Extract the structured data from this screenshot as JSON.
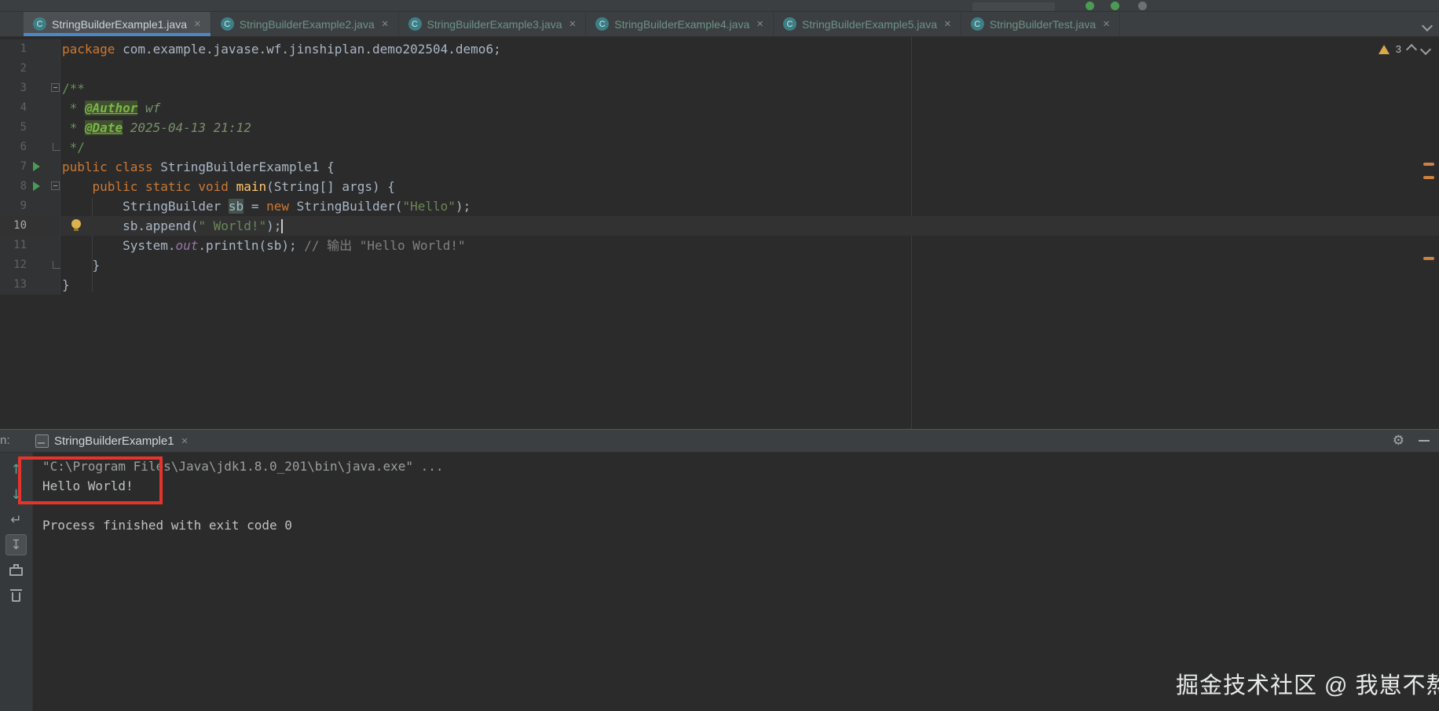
{
  "colors": {
    "accent_blue": "#4a88c7",
    "keyword_orange": "#cc7832",
    "string_green": "#6a8759",
    "warning_orange": "#d9a74a",
    "run_green": "#499c54",
    "annotation_red": "#e5342b",
    "editor_bg": "#2b2b2b",
    "panel_bg": "#3c3f41"
  },
  "tabs": {
    "icon_letter": "C",
    "close_glyph": "×",
    "items": [
      {
        "label": "StringBuilderExample1.java",
        "active": true
      },
      {
        "label": "StringBuilderExample2.java",
        "active": false
      },
      {
        "label": "StringBuilderExample3.java",
        "active": false
      },
      {
        "label": "StringBuilderExample4.java",
        "active": false
      },
      {
        "label": "StringBuilderExample5.java",
        "active": false
      },
      {
        "label": "StringBuilderTest.java",
        "active": false
      }
    ]
  },
  "inspections": {
    "warning_count": "3"
  },
  "editor": {
    "scroll_marks": [
      160,
      177,
      280
    ],
    "lines": [
      {
        "num": "1",
        "segments": [
          {
            "c": "kw",
            "t": "package "
          },
          {
            "c": "pl",
            "t": "com.example.javase.wf.jinshiplan.demo202504.demo6;"
          }
        ]
      },
      {
        "num": "2",
        "segments": []
      },
      {
        "num": "3",
        "fold": "open",
        "segments": [
          {
            "c": "doc",
            "t": "/**"
          }
        ]
      },
      {
        "num": "4",
        "segments": [
          {
            "c": "doc",
            "t": " * "
          },
          {
            "c": "doctag",
            "t": "@Author"
          },
          {
            "c": "docval",
            "t": " wf"
          }
        ]
      },
      {
        "num": "5",
        "segments": [
          {
            "c": "doc",
            "t": " * "
          },
          {
            "c": "doctag",
            "t": "@Date"
          },
          {
            "c": "docval",
            "t": " 2025-04-13 21:12"
          }
        ]
      },
      {
        "num": "6",
        "fold": "end",
        "segments": [
          {
            "c": "doc",
            "t": " */"
          }
        ]
      },
      {
        "num": "7",
        "run": true,
        "segments": [
          {
            "c": "kw",
            "t": "public class "
          },
          {
            "c": "pl",
            "t": "StringBuilderExample1 {"
          }
        ]
      },
      {
        "num": "8",
        "run": true,
        "fold": "open",
        "segments": [
          {
            "c": "pl",
            "t": "    "
          },
          {
            "c": "kw",
            "t": "public static void "
          },
          {
            "c": "mth",
            "t": "main"
          },
          {
            "c": "pl",
            "t": "(String[] args) {"
          }
        ]
      },
      {
        "num": "9",
        "segments": [
          {
            "c": "pl",
            "t": "        StringBuilder "
          },
          {
            "c": "hl",
            "t": "sb"
          },
          {
            "c": "pl",
            "t": " = "
          },
          {
            "c": "kw",
            "t": "new"
          },
          {
            "c": "pl",
            "t": " StringBuilder("
          },
          {
            "c": "str",
            "t": "\"Hello\""
          },
          {
            "c": "pl",
            "t": ");"
          }
        ]
      },
      {
        "num": "10",
        "current": true,
        "bulb": true,
        "segments": [
          {
            "c": "pl",
            "t": "        sb.append("
          },
          {
            "c": "str",
            "t": "\" World!\""
          },
          {
            "c": "pl",
            "t": ");"
          },
          {
            "c": "caret",
            "t": ""
          }
        ]
      },
      {
        "num": "11",
        "segments": [
          {
            "c": "pl",
            "t": "        System."
          },
          {
            "c": "fld",
            "t": "out"
          },
          {
            "c": "pl",
            "t": ".println(sb); "
          },
          {
            "c": "cm",
            "t": "// 输出 \"Hello World!\""
          }
        ]
      },
      {
        "num": "12",
        "fold": "end",
        "segments": [
          {
            "c": "pl",
            "t": "    }"
          }
        ]
      },
      {
        "num": "13",
        "segments": [
          {
            "c": "pl",
            "t": "}"
          }
        ]
      }
    ]
  },
  "console": {
    "run_label_partial": "n:",
    "tab": {
      "label": "StringBuilderExample1",
      "close_glyph": "×"
    },
    "header": {
      "gear_glyph": "⚙"
    },
    "toolbar": [
      {
        "name": "navigate-up-button",
        "glyph": "↑",
        "cls": "teal"
      },
      {
        "name": "navigate-down-button",
        "glyph": "↓",
        "cls": "teal"
      },
      {
        "name": "soft-wrap-button",
        "glyph": "↵",
        "cls": "gray"
      },
      {
        "name": "scroll-to-end-button",
        "glyph": "↧",
        "cls": "gray",
        "selected": true
      },
      {
        "name": "print-button",
        "shape": "printer"
      },
      {
        "name": "clear-button",
        "shape": "trash"
      }
    ],
    "lines": [
      {
        "c": "dim",
        "t": "\"C:\\Program Files\\Java\\jdk1.8.0_201\\bin\\java.exe\" ..."
      },
      {
        "c": "out",
        "t": "Hello World!"
      },
      {
        "c": "out",
        "t": ""
      },
      {
        "c": "out",
        "t": "Process finished with exit code 0"
      }
    ]
  },
  "watermark": {
    "text": "掘金技术社区 @ 我崽不熬夜"
  }
}
